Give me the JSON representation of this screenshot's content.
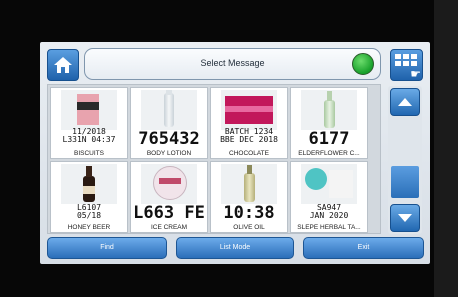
{
  "header": {
    "title": "Select Message",
    "status_color": "#2db33a",
    "home_icon": "home-icon",
    "grid_icon": "grid-menu-icon"
  },
  "messages": [
    {
      "lines": [
        "11/2018",
        "L331N 04:37"
      ],
      "label": "BISCUITS",
      "style": "small"
    },
    {
      "lines": [
        "765432"
      ],
      "label": "BODY LOTION",
      "style": "big"
    },
    {
      "lines": [
        "BATCH 1234",
        "BBE DEC 2018"
      ],
      "label": "CHOCOLATE",
      "style": "small"
    },
    {
      "lines": [
        "6177"
      ],
      "label": "ELDERFLOWER C...",
      "style": "big"
    },
    {
      "lines": [
        "L6107",
        "05/18"
      ],
      "label": "HONEY BEER",
      "style": "small"
    },
    {
      "lines": [
        "L663 FE"
      ],
      "label": "ICE CREAM",
      "style": "big"
    },
    {
      "lines": [
        "10:38"
      ],
      "label": "OLIVE OIL",
      "style": "big"
    },
    {
      "lines": [
        "SA947",
        "JAN 2020"
      ],
      "label": "SLEPE HERBAL TA...",
      "style": "small"
    }
  ],
  "scroll": {
    "up_icon": "arrow-up-icon",
    "down_icon": "arrow-down-icon"
  },
  "buttons": {
    "find": "Find",
    "list_mode": "List Mode",
    "exit": "Exit"
  }
}
